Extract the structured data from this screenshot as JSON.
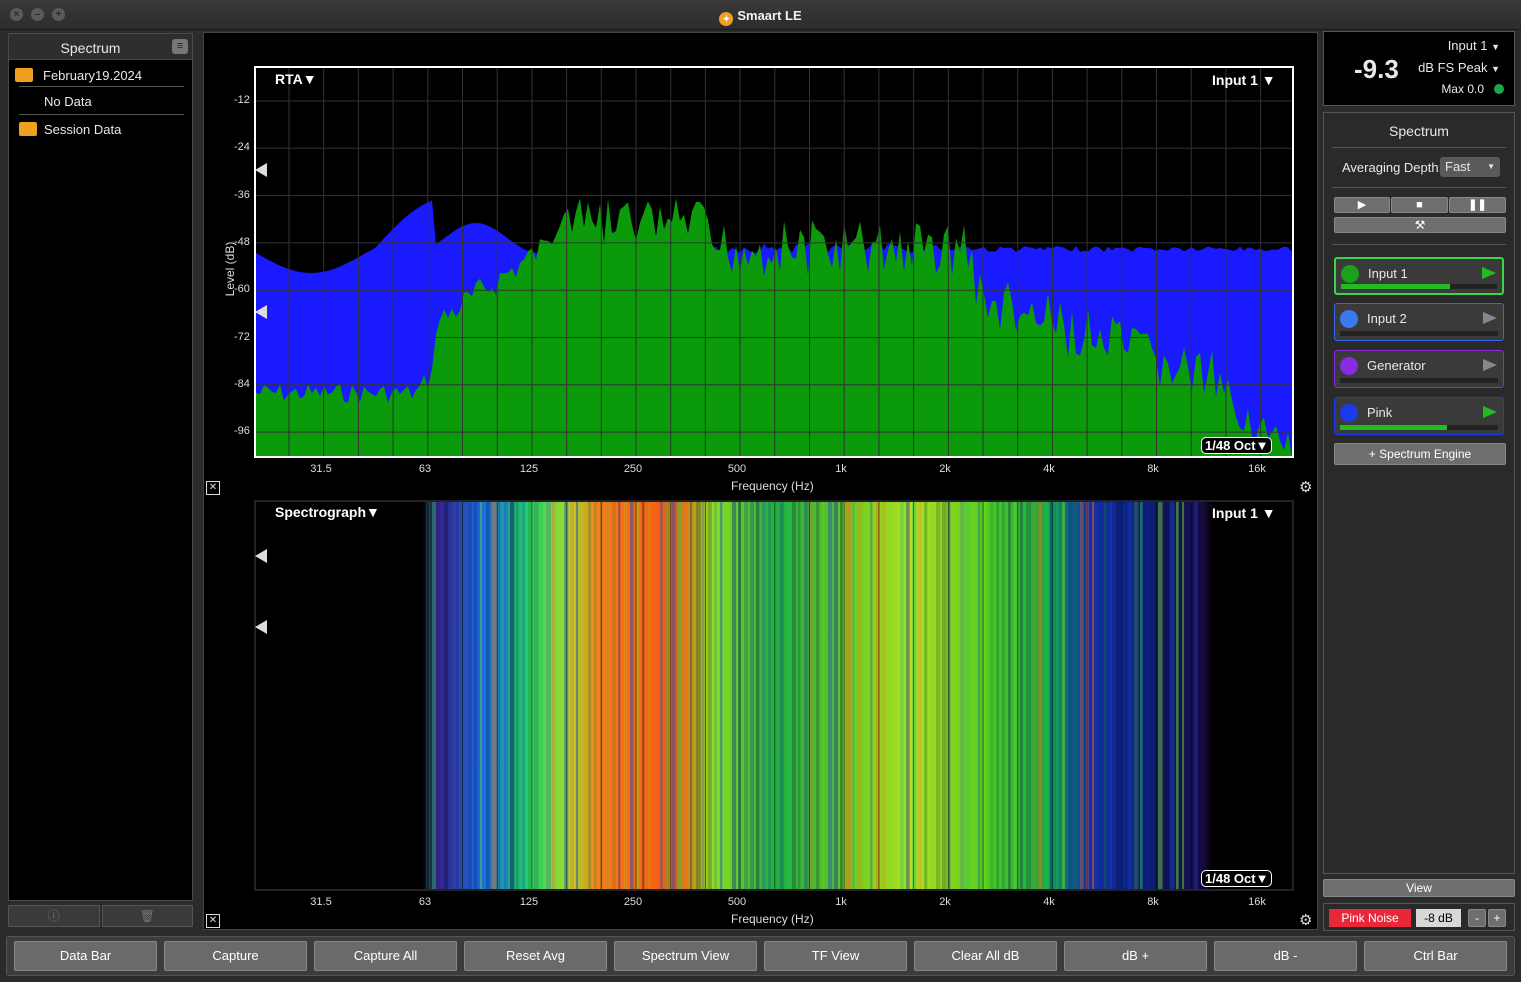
{
  "app": {
    "title": "Smaart LE"
  },
  "left_panel": {
    "title": "Spectrum",
    "items": [
      {
        "label": "February19.2024",
        "type": "folder-open"
      },
      {
        "label": "No Data",
        "type": "entry"
      },
      {
        "label": "Session Data",
        "type": "folder"
      }
    ]
  },
  "rta": {
    "title": "RTA▼",
    "input": "Input 1 ▼",
    "resolution": "1/48 Oct▼",
    "ylabel": "Level (dB)",
    "xlabel": "Frequency (Hz)",
    "yticks": [
      "-12",
      "-24",
      "-36",
      "-48",
      "-60",
      "-72",
      "-84",
      "-96"
    ],
    "xticks": [
      "31.5",
      "63",
      "125",
      "250",
      "500",
      "1k",
      "2k",
      "4k",
      "8k",
      "16k"
    ]
  },
  "spectrograph": {
    "title": "Spectrograph▼",
    "input": "Input 1 ▼",
    "resolution": "1/48 Oct▼",
    "xlabel": "Frequency (Hz)",
    "xticks": [
      "31.5",
      "63",
      "125",
      "250",
      "500",
      "1k",
      "2k",
      "4k",
      "8k",
      "16k"
    ]
  },
  "meter": {
    "input": "Input 1",
    "value": "-9.3",
    "unit": "dB FS Peak",
    "max": "Max 0.0"
  },
  "spectrum_panel": {
    "title": "Spectrum",
    "averaging_label": "Averaging Depth:",
    "averaging_value": "Fast",
    "channels": [
      {
        "name": "Input 1",
        "color": "#22aa22",
        "level": 0.7,
        "active": true
      },
      {
        "name": "Input 2",
        "color": "#3366ee",
        "level": 0.0,
        "active": false
      },
      {
        "name": "Generator",
        "color": "#8a2be2",
        "level": 0.0,
        "active": false
      },
      {
        "name": "Pink",
        "color": "#1a3aee",
        "level": 0.68,
        "active": true
      }
    ],
    "add_engine": "+ Spectrum Engine",
    "view_label": "View"
  },
  "generator": {
    "label": "Pink Noise",
    "level": "-8 dB",
    "minus": "-",
    "plus": "+"
  },
  "bottom_buttons": [
    "Data Bar",
    "Capture",
    "Capture All",
    "Reset Avg",
    "Spectrum View",
    "TF View",
    "Clear All dB",
    "dB +",
    "dB -",
    "Ctrl Bar"
  ],
  "colors": {
    "green": "#0a9a0a",
    "blue": "#1a1aff",
    "red": "#e8283a"
  }
}
